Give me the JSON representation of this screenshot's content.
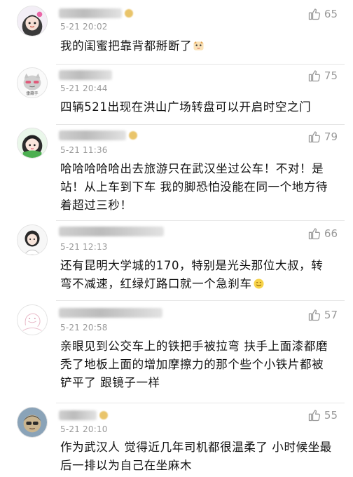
{
  "comments": [
    {
      "timestamp": "5-21 20:02",
      "likes": "65",
      "text": "我的闺蜜把靠背都掰断了",
      "emoji": "cat-face-emoji"
    },
    {
      "timestamp": "5-21 20:44",
      "likes": "75",
      "text": "四辆521出现在洪山广场转盘可以开启时空之门"
    },
    {
      "timestamp": "5-21 11:36",
      "likes": "79",
      "text": "哈哈哈哈哈出去旅游只在武汉坐过公车！不对！是站！从上车到下车 我的脚恐怕没能在同一个地方待着超过三秒！"
    },
    {
      "timestamp": "5-21 12:13",
      "likes": "66",
      "text": "还有昆明大学城的170，特别是光头那位大叔，转弯不减速，红绿灯路口就一个急刹车",
      "emoji": "smile-emoji"
    },
    {
      "timestamp": "5-21 20:58",
      "likes": "57",
      "text": "亲眼见到公交车上的铁把手被拉弯 扶手上面漆都磨秃了地板上面的增加摩擦力的那个些个小铁片都被铲平了 跟镜子一样"
    },
    {
      "timestamp": "5-21 20:10",
      "likes": "55",
      "text": "作为武汉人 觉得近几年司机都很温柔了 小时候坐最后一排以为自己在坐麻木"
    }
  ],
  "avatar_badge_text": "雷藏手"
}
